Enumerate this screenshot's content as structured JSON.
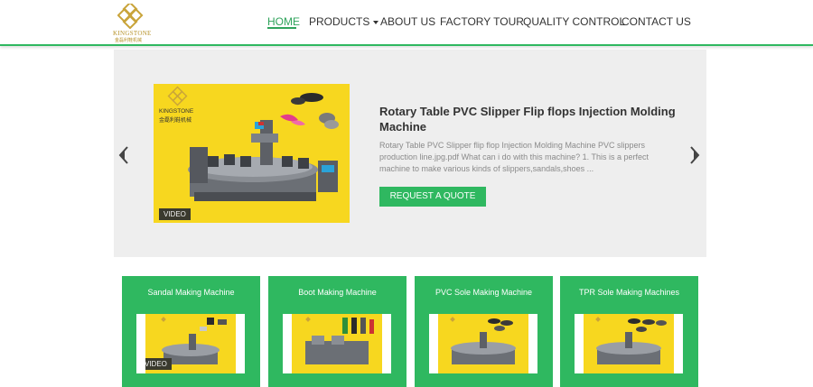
{
  "brand": {
    "name": "KINGSTONE",
    "sub": "金磊利鞋机械"
  },
  "nav": {
    "items": [
      {
        "label": "HOME",
        "active": true
      },
      {
        "label": "PRODUCTS",
        "dropdown": true
      },
      {
        "label": "ABOUT US"
      },
      {
        "label": "FACTORY TOUR"
      },
      {
        "label": "QUALITY CONTROL"
      },
      {
        "label": "CONTACT US"
      }
    ]
  },
  "slider": {
    "image_brand": "KINGSTONE",
    "image_brand_cn": "金磊利鞋机械",
    "video_badge": "VIDEO",
    "title": "Rotary Table PVC Slipper Flip flops Injection Molding Machine",
    "description": "Rotary Table PVC Slipper flip flop Injection Molding Machine PVC slippers production line.jpg.pdf What can i do with this machine? 1. This is a perfect machine to make various kinds of slippers,sandals,shoes ...",
    "cta_label": "REQUEST A QUOTE"
  },
  "categories": [
    {
      "label": "Sandal Making Machine",
      "video_badge": "VIDEO"
    },
    {
      "label": "Boot Making Machine"
    },
    {
      "label": "PVC Sole Making Machine"
    },
    {
      "label": "TPR Sole Making Machines"
    }
  ],
  "colors": {
    "accent": "#2fb860",
    "product_bg": "#f7d71f",
    "slider_bg": "#eeeeee"
  }
}
